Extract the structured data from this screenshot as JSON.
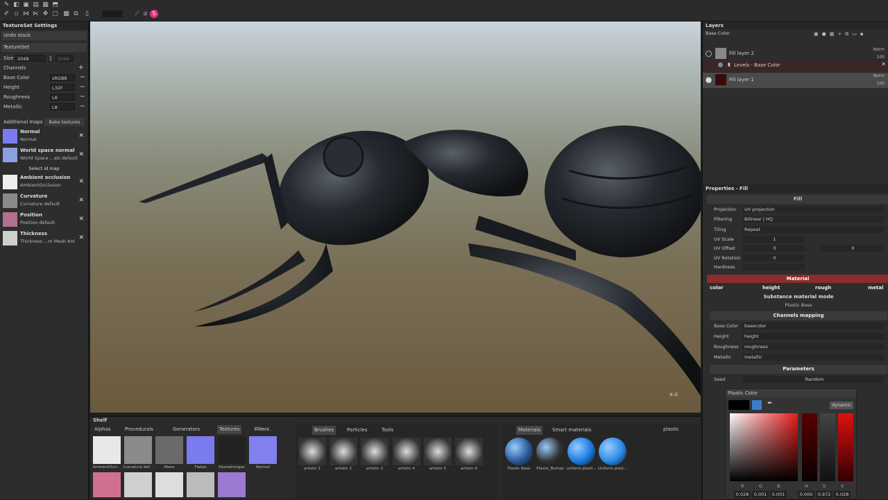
{
  "textureset": {
    "title": "TextureSet Settings",
    "undo_stack": "Undo stack",
    "textureset_label": "TextureSet",
    "size_label": "Size",
    "size_value": "2048",
    "size_value2": "2048",
    "channels_label": "Channels",
    "channels": [
      {
        "name": "Base Color",
        "format": "sRGB8"
      },
      {
        "name": "Height",
        "format": "L32F"
      },
      {
        "name": "Roughness",
        "format": "L8"
      },
      {
        "name": "Metallic",
        "format": "L8"
      }
    ],
    "additional_maps": "Additional maps",
    "bake_textures": "Bake textures",
    "select_id_map": "Select id map",
    "maps": [
      {
        "title": "Normal",
        "sub": "Normal",
        "color": "#7b7bf0"
      },
      {
        "title": "World space normal",
        "sub": "World Space ...als default",
        "color": "#8aa0e0"
      },
      {
        "title": "Ambient occlusion",
        "sub": "AmbientOcclusion",
        "color": "#eeeeee"
      },
      {
        "title": "Curvature",
        "sub": "Curvature default",
        "color": "#8a8a8a"
      },
      {
        "title": "Position",
        "sub": "Position default",
        "color": "#b07090"
      },
      {
        "title": "Thickness",
        "sub": "Thickness ...m Mesh Ant",
        "color": "#cfcfcf"
      }
    ]
  },
  "layers": {
    "title": "Layers",
    "channel": "Base Color",
    "items": [
      {
        "name": "Fill layer 2",
        "blend": "Norm",
        "opacity": "100"
      },
      {
        "name": "Levels - Base Color"
      },
      {
        "name": "Fill layer 1",
        "blend": "Norm",
        "opacity": "100"
      }
    ]
  },
  "properties": {
    "title": "Properties - Fill",
    "fill_header": "Fill",
    "rows": [
      {
        "label": "Projection",
        "value": "UV projection"
      },
      {
        "label": "Filtering",
        "value": "Bilinear | HQ"
      },
      {
        "label": "Tiling",
        "value": "Repeat"
      },
      {
        "label": "UV Scale",
        "value": "1"
      },
      {
        "label": "UV Offset",
        "value": "0"
      },
      {
        "label": "UV Rotation",
        "value": "0"
      },
      {
        "label": "Hardness",
        "value": ""
      }
    ],
    "uv_offset_2": "0",
    "material_header": "Material",
    "material_channels": [
      "color",
      "height",
      "rough",
      "metal"
    ],
    "substance_mode": "Substance material mode",
    "plastic_base": "Plastic Base",
    "channels_mapping": "Channels mapping",
    "mapping": [
      {
        "label": "Base Color",
        "value": "basecolor"
      },
      {
        "label": "Height",
        "value": "height"
      },
      {
        "label": "Roughness",
        "value": "roughness"
      },
      {
        "label": "Metallic",
        "value": "metallic"
      }
    ],
    "parameters": "Parameters",
    "seed_label": "Seed",
    "seed_value": "Random"
  },
  "color_popup": {
    "title": "Plastic Color",
    "dynamic": "dynamic",
    "labels": [
      "R",
      "G",
      "B",
      "H",
      "S",
      "V"
    ],
    "values": [
      "0.028",
      "0.001",
      "0.001",
      "0.000",
      "0.972",
      "0.028"
    ]
  },
  "shelf": {
    "title": "Shelf",
    "tabs": [
      "Alphas",
      "Procedurals",
      "Generators",
      "Textures",
      "Filters"
    ],
    "search_placeholder": "Search...",
    "texture_items": [
      "AmbientOccl...",
      "Curvature def...",
      "fibers",
      "Flakes",
      "fresnelranges",
      "Normal"
    ],
    "brush_tabs": [
      "Brushes",
      "Particles",
      "Tools"
    ],
    "brush_items": [
      "artistic 1",
      "artistic 2",
      "artistic 3",
      "artistic 4",
      "artistic 5",
      "artistic 6"
    ],
    "material_tabs": [
      "Materials",
      "Smart materials"
    ],
    "material_filter": "plastic",
    "material_items": [
      "Plastic Base",
      "Plastic_Bumps",
      "uniform plasti...",
      "Uniform plast..."
    ]
  }
}
